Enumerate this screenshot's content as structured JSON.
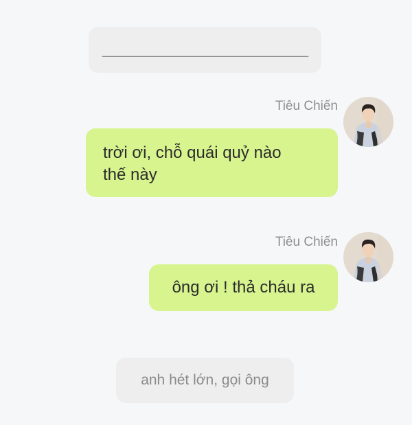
{
  "conversation": {
    "system_top": "____________________________",
    "messages": [
      {
        "sender": "Tiêu Chiến",
        "text": "trời ơi, chỗ quái quỷ nào\nthế này",
        "avatar": "person-photo-avatar"
      },
      {
        "sender": "Tiêu Chiến",
        "text": "ông ơi ! thả cháu ra",
        "avatar": "person-photo-avatar"
      }
    ],
    "system_bottom": "anh hét lớn, gọi ông"
  },
  "colors": {
    "background": "#f6f7f9",
    "system_bubble": "#eeeeef",
    "message_bubble": "#d7f48f",
    "sender_text": "#8e8e8e"
  }
}
